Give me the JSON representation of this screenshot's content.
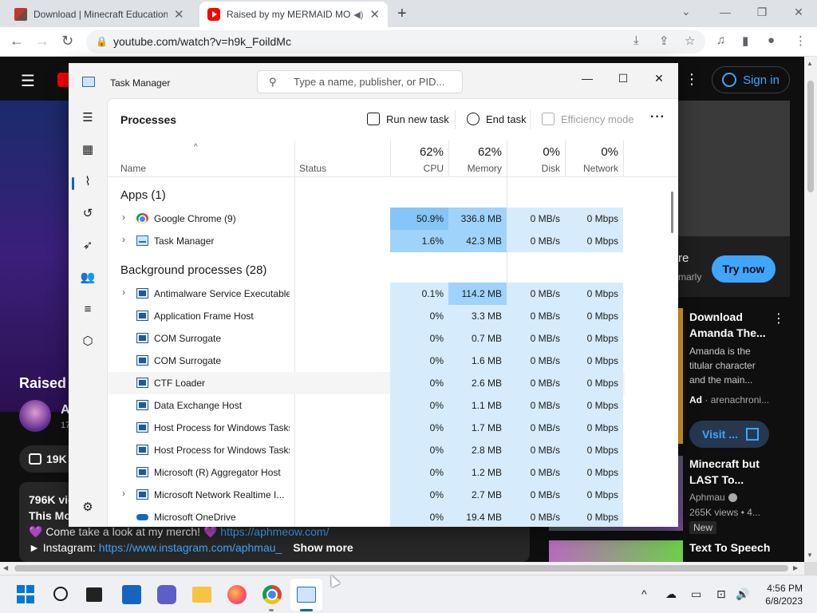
{
  "browser": {
    "tabs": [
      {
        "label": "Download | Minecraft Education"
      },
      {
        "label": "Raised by my MERMAID MO"
      }
    ],
    "url": "youtube.com/watch?v=h9k_FoildMc"
  },
  "youtube": {
    "signin": "Sign in",
    "title_fragment": "Raised",
    "channel_fragment": "A",
    "subs_fragment": "17",
    "likes_fragment": "19K",
    "views_fragment": "796K vie",
    "desc_fragment": "This Mo",
    "merch_text": "💜 Come take a look at my merch! 💜",
    "merch_link": "https://aphmeow.com/",
    "insta_prefix": "► Instagram:",
    "insta_link": "https://www.instagram.com/aphmau_",
    "show_more": "Show more",
    "ad": {
      "partial_title": "re",
      "partial_sub": "marly",
      "cta": "Try now"
    },
    "rec1": {
      "title": "Download Amanda The...",
      "desc": "Amanda is the titular character and the main...",
      "ad_label": "Ad",
      "advertiser": "arenachroni...",
      "visit": "Visit ..."
    },
    "rec2": {
      "title": "Minecraft but LAST To...",
      "channel": "Aphmau",
      "views": "265K views • 4...",
      "badge": "New"
    },
    "rec3": {
      "title": "Text To Speech"
    }
  },
  "taskmanager": {
    "title": "Task Manager",
    "search_placeholder": "Type a name, publisher, or PID...",
    "page_title": "Processes",
    "commands": {
      "run_new_task": "Run new task",
      "end_task": "End task",
      "efficiency_mode": "Efficiency mode"
    },
    "columns": {
      "name": "Name",
      "status": "Status",
      "cpu_pct": "62%",
      "cpu": "CPU",
      "mem_pct": "62%",
      "mem": "Memory",
      "disk_pct": "0%",
      "disk": "Disk",
      "net_pct": "0%",
      "net": "Network"
    },
    "groups": {
      "apps": "Apps (1)",
      "background": "Background processes (28)"
    },
    "apps": [
      {
        "name": "Google Chrome (9)",
        "cpu": "50.9%",
        "mem": "336.8 MB",
        "disk": "0 MB/s",
        "net": "0 Mbps"
      },
      {
        "name": "Task Manager",
        "cpu": "1.6%",
        "mem": "42.3 MB",
        "disk": "0 MB/s",
        "net": "0 Mbps"
      }
    ],
    "background": [
      {
        "name": "Antimalware Service Executable",
        "cpu": "0.1%",
        "mem": "114.2 MB",
        "disk": "0 MB/s",
        "net": "0 Mbps"
      },
      {
        "name": "Application Frame Host",
        "cpu": "0%",
        "mem": "3.3 MB",
        "disk": "0 MB/s",
        "net": "0 Mbps"
      },
      {
        "name": "COM Surrogate",
        "cpu": "0%",
        "mem": "0.7 MB",
        "disk": "0 MB/s",
        "net": "0 Mbps"
      },
      {
        "name": "COM Surrogate",
        "cpu": "0%",
        "mem": "1.6 MB",
        "disk": "0 MB/s",
        "net": "0 Mbps"
      },
      {
        "name": "CTF Loader",
        "cpu": "0%",
        "mem": "2.6 MB",
        "disk": "0 MB/s",
        "net": "0 Mbps"
      },
      {
        "name": "Data Exchange Host",
        "cpu": "0%",
        "mem": "1.1 MB",
        "disk": "0 MB/s",
        "net": "0 Mbps"
      },
      {
        "name": "Host Process for Windows Tasks",
        "cpu": "0%",
        "mem": "1.7 MB",
        "disk": "0 MB/s",
        "net": "0 Mbps"
      },
      {
        "name": "Host Process for Windows Tasks",
        "cpu": "0%",
        "mem": "2.8 MB",
        "disk": "0 MB/s",
        "net": "0 Mbps"
      },
      {
        "name": "Microsoft (R) Aggregator Host",
        "cpu": "0%",
        "mem": "1.2 MB",
        "disk": "0 MB/s",
        "net": "0 Mbps"
      },
      {
        "name": "Microsoft Network Realtime I...",
        "cpu": "0%",
        "mem": "2.7 MB",
        "disk": "0 MB/s",
        "net": "0 Mbps"
      },
      {
        "name": "Microsoft OneDrive",
        "cpu": "0%",
        "mem": "19.4 MB",
        "disk": "0 MB/s",
        "net": "0 Mbps"
      }
    ]
  },
  "taskbar": {
    "time": "4:56 PM",
    "date": "6/8/2023"
  }
}
